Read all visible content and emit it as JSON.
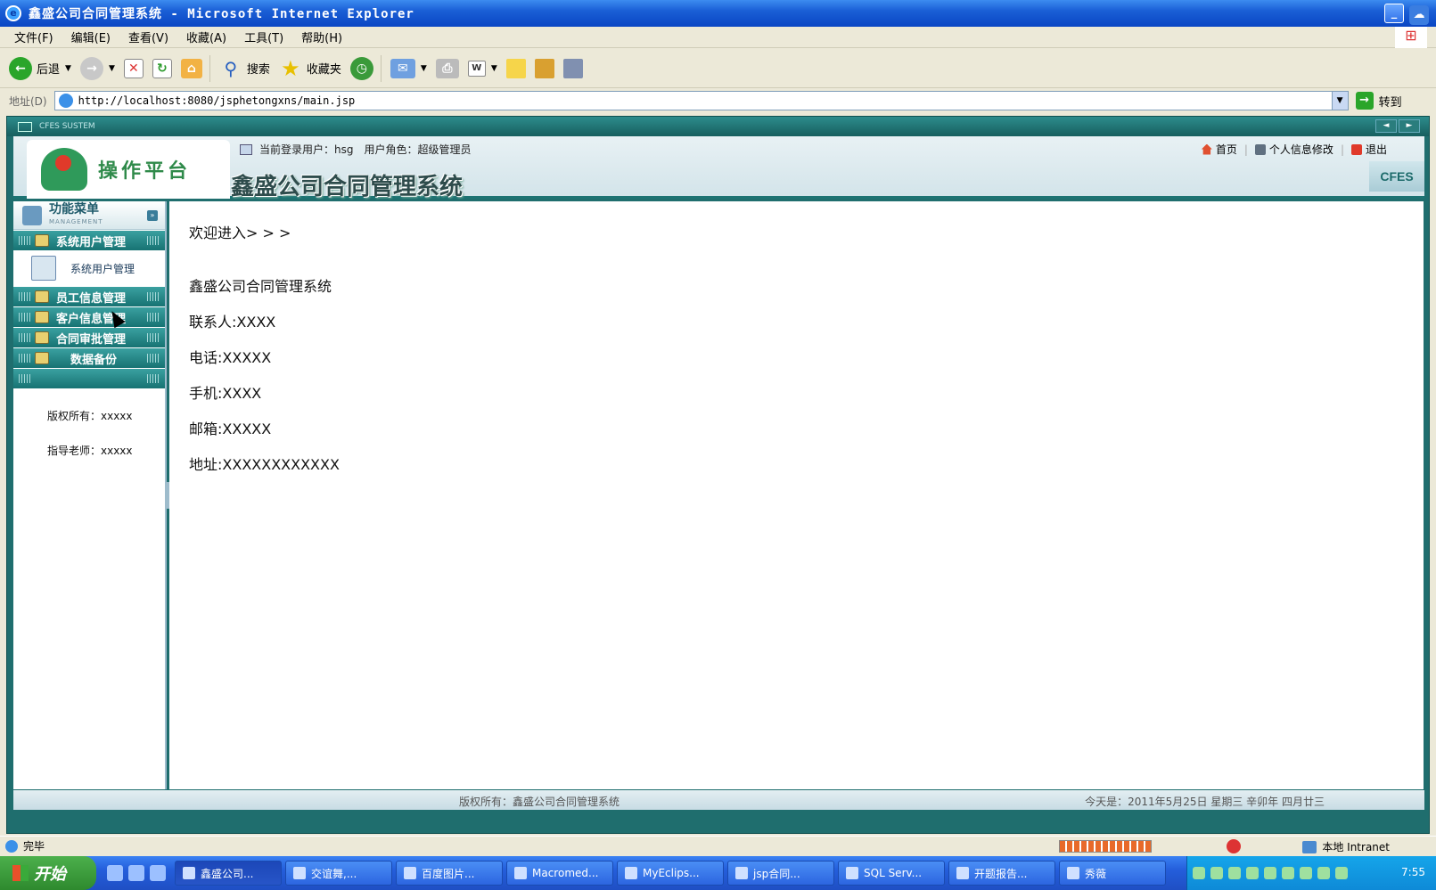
{
  "window": {
    "title": "鑫盛公司合同管理系统 - Microsoft Internet Explorer",
    "buttons": [
      "_",
      "□",
      "x"
    ]
  },
  "menubar": [
    "文件(F)",
    "编辑(E)",
    "查看(V)",
    "收藏(A)",
    "工具(T)",
    "帮助(H)"
  ],
  "toolbar": {
    "back": "后退",
    "search": "搜索",
    "favorites": "收藏夹"
  },
  "address": {
    "label": "地址(D)",
    "url": "http://localhost:8080/jsphetongxns/main.jsp",
    "go": "转到"
  },
  "page": {
    "brand_bar": "CFES SUSTEM",
    "logo_text": "操作平台",
    "system_name": "鑫盛公司合同管理系统",
    "current_user_label": "当前登录用户：hsg",
    "role_label": "用户角色：超级管理员",
    "links": {
      "home": "首页",
      "profile": "个人信息修改",
      "logout": "退出"
    },
    "cfes_tag": "CFES",
    "sidebar": {
      "title": "功能菜单",
      "subtitle": "MANAGEMENT",
      "categories": [
        {
          "label": "系统用户管理"
        },
        {
          "label": "员工信息管理"
        },
        {
          "label": "客户信息管理"
        },
        {
          "label": "合同审批管理"
        },
        {
          "label": "数据备份"
        }
      ],
      "sub_item": "系统用户管理",
      "copyright": "版权所有：xxxxx",
      "teacher": "指导老师：xxxxx"
    },
    "main": {
      "welcome": "欢迎进入> > >",
      "lines": [
        "鑫盛公司合同管理系统",
        "联系人:XXXX",
        "电话:XXXXX",
        "手机:XXXX",
        "邮箱:XXXXX",
        "地址:XXXXXXXXXXXX"
      ]
    },
    "footer": {
      "copyright": "版权所有：鑫盛公司合同管理系统",
      "date": "今天是：2011年5月25日 星期三 辛卯年 四月廿三"
    }
  },
  "statusbar": {
    "text": "完毕",
    "zone": "本地 Intranet"
  },
  "taskbar": {
    "start": "开始",
    "tasks": [
      "鑫盛公司...",
      "交谊舞,...",
      "百度图片...",
      "Macromed...",
      "MyEclips...",
      "jsp合同...",
      "SQL Serv...",
      "开题报告...",
      "秀薇"
    ],
    "clock": "7:55"
  }
}
